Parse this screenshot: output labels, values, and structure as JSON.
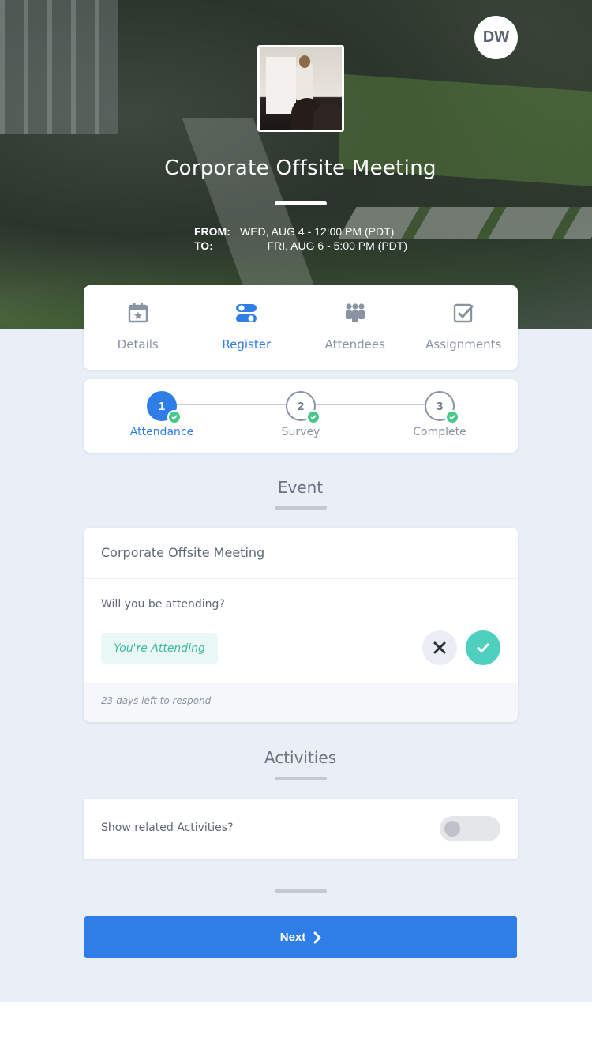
{
  "user": {
    "initials": "DW"
  },
  "event": {
    "title": "Corporate Offsite Meeting",
    "from_label": "FROM:",
    "from_value": "WED, AUG 4 - 12:00 PM (PDT)",
    "to_label": "TO:",
    "to_value": "FRI, AUG 6 - 5:00 PM (PDT)"
  },
  "tabs": [
    {
      "label": "Details",
      "icon": "calendar-star-icon",
      "active": false
    },
    {
      "label": "Register",
      "icon": "toggles-icon",
      "active": true
    },
    {
      "label": "Attendees",
      "icon": "people-group-icon",
      "active": false
    },
    {
      "label": "Assignments",
      "icon": "checkbox-icon",
      "active": false
    }
  ],
  "steps": [
    {
      "number": "1",
      "label": "Attendance",
      "current": true,
      "completed": true
    },
    {
      "number": "2",
      "label": "Survey",
      "current": false,
      "completed": true
    },
    {
      "number": "3",
      "label": "Complete",
      "current": false,
      "completed": true
    }
  ],
  "event_section": {
    "heading": "Event",
    "card_title": "Corporate Offsite Meeting",
    "question": "Will you be attending?",
    "status": "You're Attending",
    "deadline": "23 days left to respond"
  },
  "activities_section": {
    "heading": "Activities",
    "toggle_label": "Show related Activities?",
    "toggle_on": false
  },
  "actions": {
    "next_label": "Next"
  },
  "colors": {
    "accent": "#2f7ee8",
    "success": "#47c98a",
    "teal": "#4fcfbe",
    "background": "#eaeef7"
  }
}
